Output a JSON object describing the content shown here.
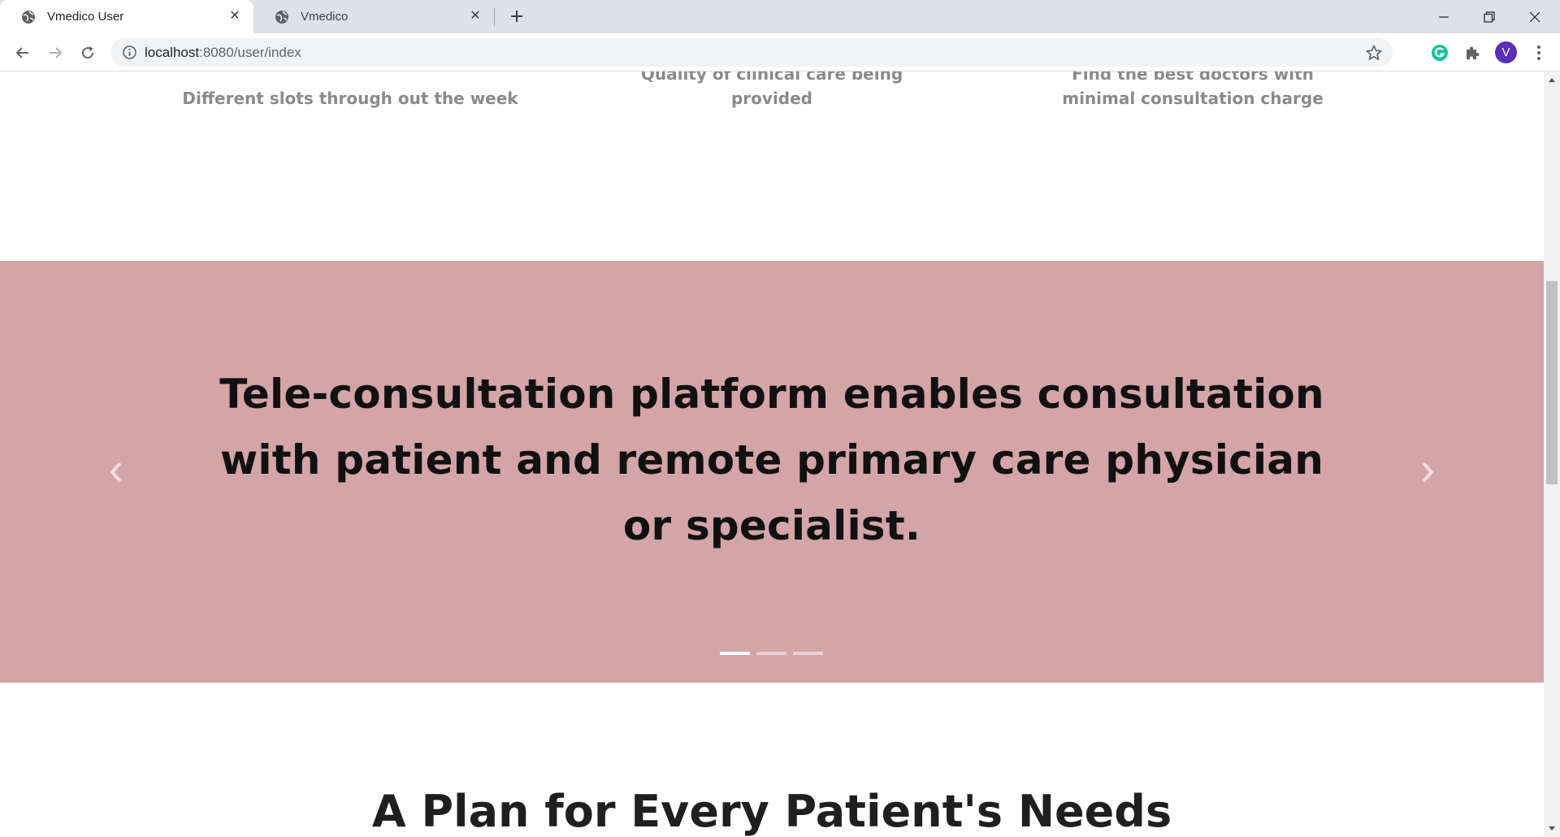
{
  "browser": {
    "tabs": [
      {
        "title": "Vmedico User",
        "active": true
      },
      {
        "title": "Vmedico",
        "active": false
      }
    ],
    "url": {
      "host": "localhost",
      "rest": ":8080/user/index"
    },
    "profile_initial": "V",
    "colors": {
      "tabstrip": "#dee1e6",
      "avatar": "#5b2fb5",
      "grammarly": "#15c39a"
    }
  },
  "features": {
    "slots_text": "Different slots through out the week",
    "care_text_partial": "Quality of clinical care being",
    "care_text_tail": "provided",
    "doctors_text_partial": "Find the best doctors with",
    "doctors_text_tail": "minimal consultation charge"
  },
  "hero": {
    "background": "#d4a5a6",
    "slides_count": 3,
    "active_slide": 1,
    "text": "Tele-consultation platform enables consultation with patient and remote primary care physician or specialist."
  },
  "plans": {
    "title": "A Plan for Every Patient's Needs"
  }
}
